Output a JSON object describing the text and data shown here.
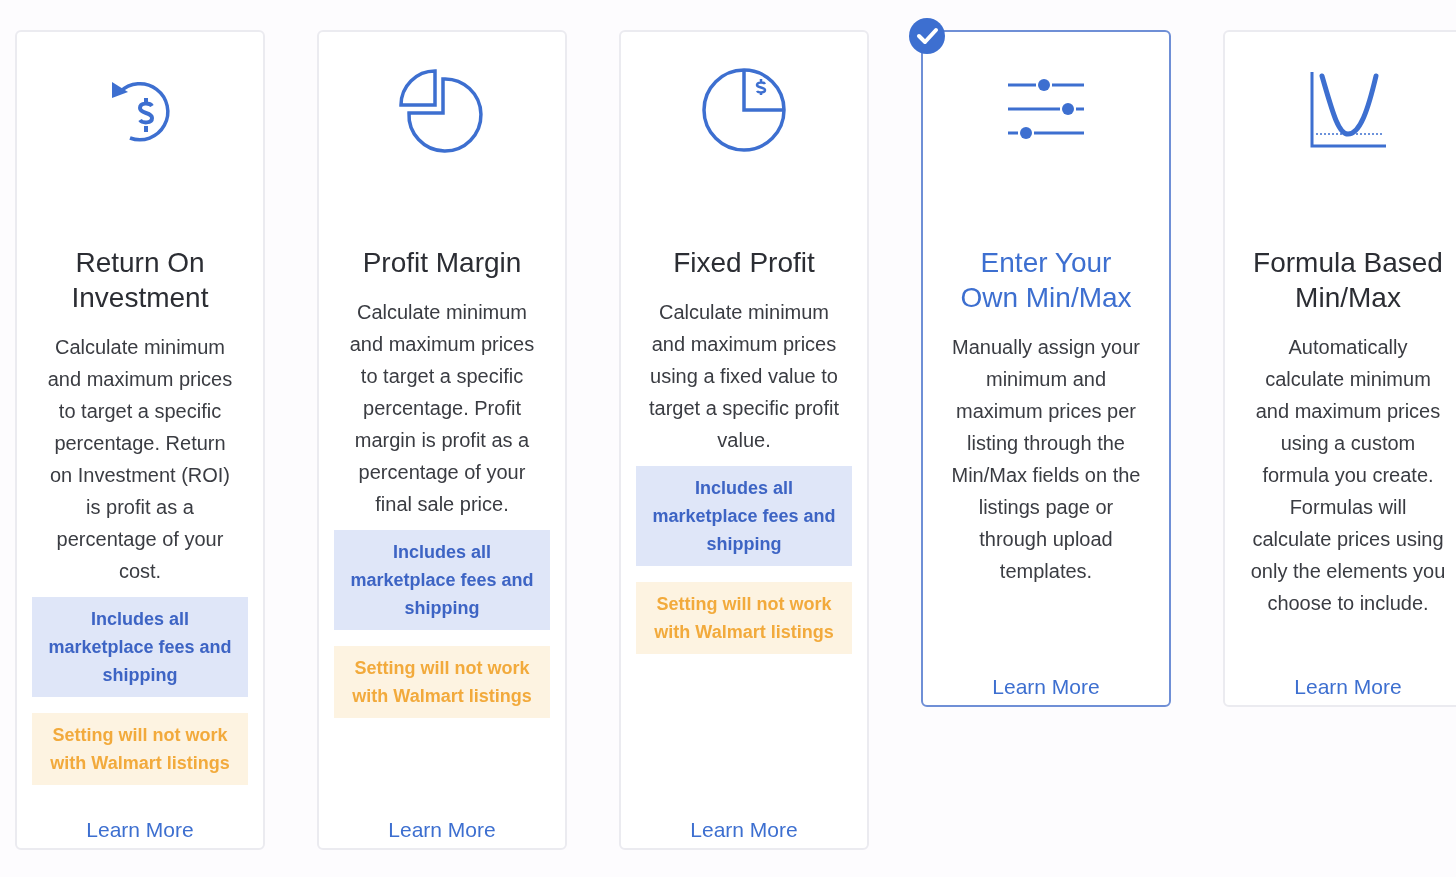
{
  "cards": [
    {
      "title": "Return On Investment",
      "selected": false,
      "description": "Calculate minimum and maximum prices to target a specific percentage. Return on Investment (ROI) is profit as a percentage of your cost.",
      "notes": [
        {
          "kind": "info",
          "text": "Includes all marketplace fees and shipping"
        },
        {
          "kind": "warning",
          "text": "Setting will not work with Walmart listings"
        }
      ],
      "link": "Learn More"
    },
    {
      "title": "Profit Margin",
      "selected": false,
      "description": "Calculate minimum and maximum prices to target a specific percentage. Profit margin is profit as a percentage of your final sale price.",
      "notes": [
        {
          "kind": "info",
          "text": "Includes all marketplace fees and shipping"
        },
        {
          "kind": "warning",
          "text": "Setting will not work with Walmart listings"
        }
      ],
      "link": "Learn More"
    },
    {
      "title": "Fixed Profit",
      "selected": false,
      "description": "Calculate minimum and maximum prices using a fixed value to target a specific profit value.",
      "notes": [
        {
          "kind": "info",
          "text": "Includes all marketplace fees and shipping"
        },
        {
          "kind": "warning",
          "text": "Setting will not work with Walmart listings"
        }
      ],
      "link": "Learn More"
    },
    {
      "title": "Enter Your Own Min/Max",
      "selected": true,
      "description": "Manually assign your minimum and maximum prices per listing through the Min/Max fields on the listings page or through upload templates.",
      "link": "Learn More"
    },
    {
      "title": "Formula Based Min/Max",
      "selected": false,
      "description": "Automatically calculate minimum and maximum prices using a custom formula you create. Formulas will calculate prices using only the elements you choose to include.",
      "link": "Learn More"
    }
  ]
}
